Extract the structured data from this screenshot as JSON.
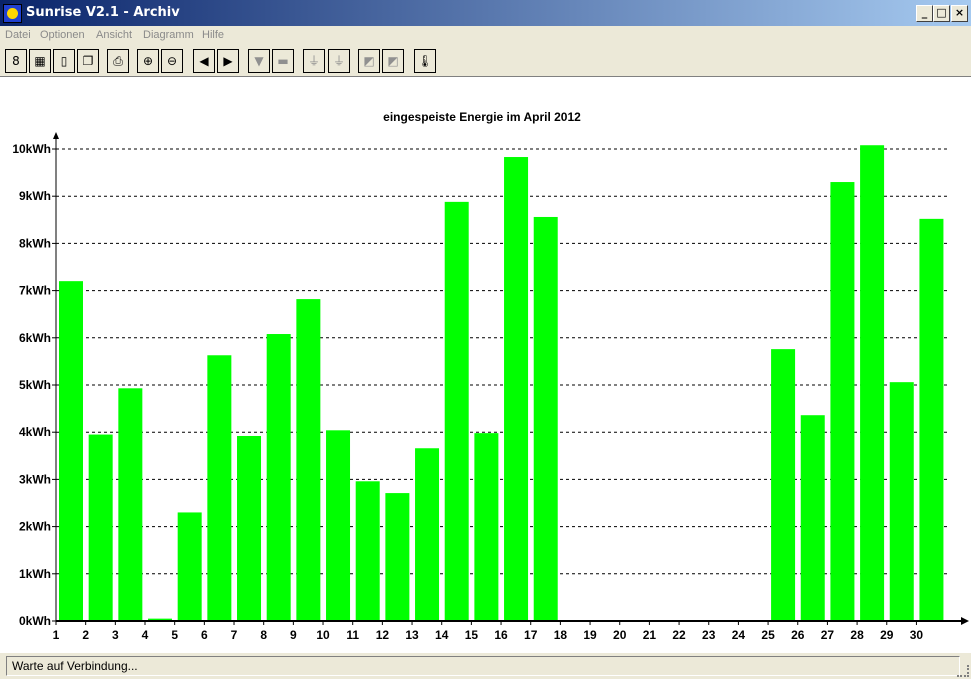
{
  "window": {
    "title": "Sunrise V2.1 - Archiv",
    "minimize": "_",
    "maximize": "□",
    "close": "×"
  },
  "menu": [
    "Datei",
    "Optionen",
    "Ansicht",
    "Diagramm",
    "Hilfe"
  ],
  "toolbar": [
    {
      "icon": "binoculars-icon",
      "glyph": "8",
      "enabled": true
    },
    {
      "icon": "chart-grid-icon",
      "glyph": "▦",
      "enabled": true
    },
    {
      "icon": "page-icon",
      "glyph": "▯",
      "enabled": true
    },
    {
      "icon": "windows-icon",
      "glyph": "❐",
      "enabled": true
    },
    {
      "icon": "printer-icon",
      "glyph": "⎙",
      "enabled": true
    },
    {
      "icon": "zoom-in-icon",
      "glyph": "⊕",
      "enabled": true
    },
    {
      "icon": "zoom-out-icon",
      "glyph": "⊖",
      "enabled": true
    },
    {
      "icon": "previous-icon",
      "glyph": "◀",
      "enabled": true
    },
    {
      "icon": "next-icon",
      "glyph": "▶",
      "enabled": true
    },
    {
      "icon": "pin-icon",
      "glyph": "▼",
      "enabled": false
    },
    {
      "icon": "panel-icon",
      "glyph": "▬",
      "enabled": false
    },
    {
      "icon": "plug-icon",
      "glyph": "⏚",
      "enabled": false
    },
    {
      "icon": "unplug-icon",
      "glyph": "⏚",
      "enabled": false
    },
    {
      "icon": "solar-panel-icon",
      "glyph": "◩",
      "enabled": false
    },
    {
      "icon": "solar-panel-2-icon",
      "glyph": "◩",
      "enabled": false
    },
    {
      "icon": "thermometer-icon",
      "glyph": "🌡",
      "enabled": true
    }
  ],
  "status": {
    "text": "Warte auf Verbindung..."
  },
  "colors": {
    "bar": "#00ff00",
    "grid": "#000000",
    "background": "#ffffff"
  },
  "chart_data": {
    "type": "bar",
    "title": "eingespeiste Energie im April 2012",
    "xlabel": "",
    "ylabel": "",
    "unit": "kWh",
    "ylim": [
      0,
      10
    ],
    "yticks": [
      "0kWh",
      "1kWh",
      "2kWh",
      "3kWh",
      "4kWh",
      "5kWh",
      "6kWh",
      "7kWh",
      "8kWh",
      "9kWh",
      "10kWh"
    ],
    "categories": [
      "1",
      "2",
      "3",
      "4",
      "5",
      "6",
      "7",
      "8",
      "9",
      "10",
      "11",
      "12",
      "13",
      "14",
      "15",
      "16",
      "17",
      "18",
      "19",
      "20",
      "21",
      "22",
      "23",
      "24",
      "25",
      "26",
      "27",
      "28",
      "29",
      "30"
    ],
    "values": [
      7.2,
      3.95,
      4.93,
      0.05,
      2.3,
      5.63,
      3.92,
      6.08,
      6.82,
      4.04,
      2.96,
      2.71,
      3.66,
      8.88,
      3.98,
      9.83,
      8.56,
      0,
      0,
      0,
      0,
      0,
      0,
      0,
      5.76,
      4.36,
      9.3,
      10.08,
      5.06,
      8.52
    ],
    "grid": true,
    "legend": "none"
  }
}
